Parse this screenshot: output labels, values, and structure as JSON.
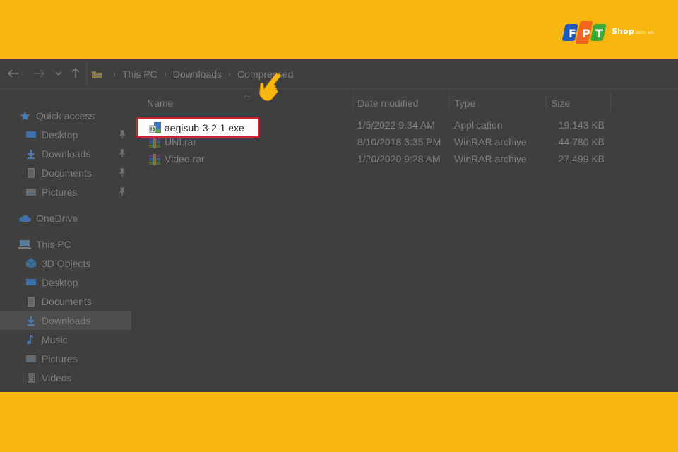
{
  "brand": {
    "logo": "FPT",
    "shop": "Shop",
    "domain": ".com.vn"
  },
  "address_bar": {
    "crumbs": [
      "This PC",
      "Downloads",
      "Compressed"
    ]
  },
  "sidebar": {
    "items": [
      {
        "label": "Quick access",
        "icon": "star-icon"
      },
      {
        "label": "Desktop",
        "icon": "desktop-icon",
        "pinned": true
      },
      {
        "label": "Downloads",
        "icon": "download-arrow-icon",
        "pinned": true
      },
      {
        "label": "Documents",
        "icon": "documents-icon",
        "pinned": true
      },
      {
        "label": "Pictures",
        "icon": "pictures-icon",
        "pinned": true
      },
      {
        "label": "OneDrive",
        "icon": "cloud-icon"
      },
      {
        "label": "This PC",
        "icon": "computer-icon"
      },
      {
        "label": "3D Objects",
        "icon": "cube-icon"
      },
      {
        "label": "Desktop",
        "icon": "desktop-icon"
      },
      {
        "label": "Documents",
        "icon": "documents-icon"
      },
      {
        "label": "Downloads",
        "icon": "download-arrow-icon",
        "selected": true
      },
      {
        "label": "Music",
        "icon": "music-note-icon"
      },
      {
        "label": "Pictures",
        "icon": "pictures-icon"
      },
      {
        "label": "Videos",
        "icon": "film-icon"
      }
    ]
  },
  "columns": {
    "name": "Name",
    "date": "Date modified",
    "type": "Type",
    "size": "Size"
  },
  "files": [
    {
      "name": "aegisub-3-2-1.exe",
      "date": "1/5/2022 9:34 AM",
      "type": "Application",
      "size": "19,143 KB",
      "icon": "setup-exe-icon",
      "highlighted": true
    },
    {
      "name": "UNI.rar",
      "date": "8/10/2018 3:35 PM",
      "type": "WinRAR archive",
      "size": "44,780 KB",
      "icon": "winrar-icon"
    },
    {
      "name": "Video.rar",
      "date": "1/20/2020 9:28 AM",
      "type": "WinRAR archive",
      "size": "27,499 KB",
      "icon": "winrar-icon"
    }
  ],
  "colors": {
    "banner": "#f8b70f",
    "window": "#3f3f3f",
    "highlight_border": "#d0242b",
    "pointer": "#f8b70f"
  }
}
